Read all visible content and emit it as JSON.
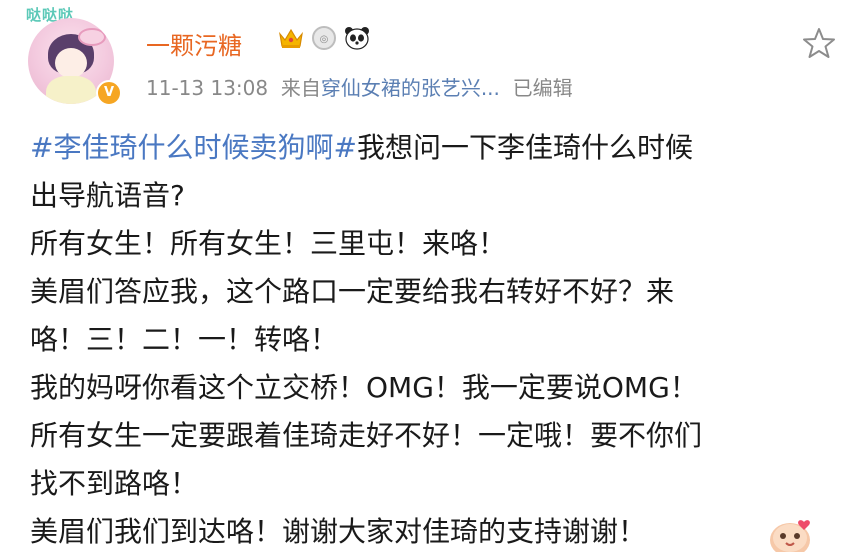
{
  "post": {
    "username": "一颗污糖",
    "avatar_frame_text": "哒哒哒",
    "verified_mark": "V",
    "timestamp": "11-13 13:08",
    "source_prefix": "来自",
    "source_name": "穿仙女裙的张艺兴...",
    "edited_label": "已编辑",
    "badges": [
      "crown-icon",
      "medal-icon",
      "panda-icon"
    ],
    "hashtag": "#李佳琦什么时候卖狗啊#",
    "lines": [
      "我想问一下李佳琦什么时候",
      "出导航语音?",
      "所有女生！所有女生！三里屯！来咯！",
      "美眉们答应我，这个路口一定要给我右转好不好？来",
      "咯！三！二！一！转咯！",
      "我的妈呀你看这个立交桥！OMG！我一定要说OMG！",
      "所有女生一定要跟着佳琦走好不好！一定哦！要不你们",
      "找不到路咯！",
      "美眉们我们到达咯！谢谢大家对佳琦的支持谢谢！"
    ]
  },
  "colors": {
    "username": "#e86722",
    "hashtag": "#4a78c2",
    "meta": "#888888",
    "source_link": "#5b7fb3",
    "text": "#1a1a1a"
  }
}
